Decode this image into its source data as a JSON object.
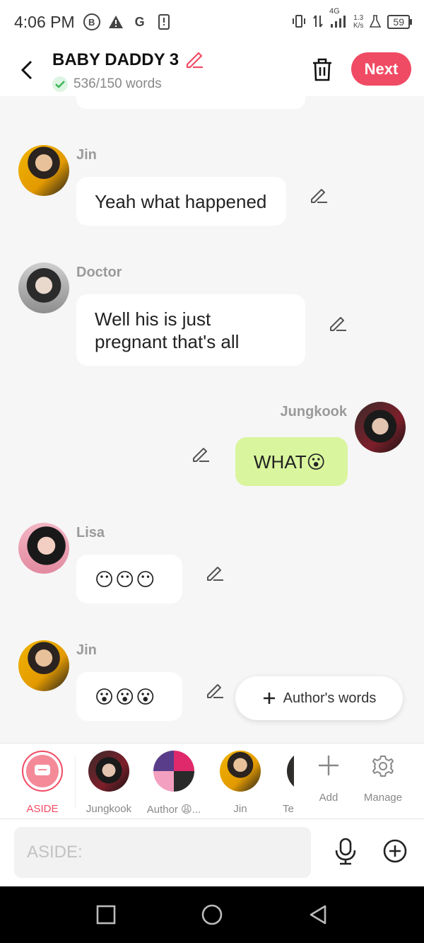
{
  "status_bar": {
    "time": "4:06 PM",
    "left_icons": [
      "b-circle-icon",
      "warning-icon",
      "google-icon",
      "phone-alert-icon"
    ],
    "network": "4G",
    "speed": "1.3",
    "speed_unit": "K/s",
    "battery": "59"
  },
  "header": {
    "title": "BABY DADDY 3",
    "word_count": "536/150 words",
    "next_label": "Next"
  },
  "messages": [
    {
      "speaker": "Jin",
      "text": "Yeah what happened",
      "side": "left"
    },
    {
      "speaker": "Doctor",
      "text": "Well his is just pregnant that's all",
      "side": "left"
    },
    {
      "speaker": "Jungkook",
      "text": "WHAT😮",
      "side": "right"
    },
    {
      "speaker": "Lisa",
      "text": "😶😶😶",
      "side": "left"
    },
    {
      "speaker": "Jin",
      "text": "😮😮😮",
      "side": "left"
    }
  ],
  "fab": {
    "label": "Author's words"
  },
  "characters": [
    {
      "label": "ASIDE",
      "selected": true
    },
    {
      "label": "Jungkook"
    },
    {
      "label": "Author 😩..."
    },
    {
      "label": "Jin"
    },
    {
      "label": "Te"
    }
  ],
  "tools": {
    "add_label": "Add",
    "manage_label": "Manage"
  },
  "input": {
    "placeholder": "ASIDE:"
  },
  "colors": {
    "accent": "#f04b64",
    "my_bubble": "#d9f59e",
    "background": "#f6f6f6"
  }
}
